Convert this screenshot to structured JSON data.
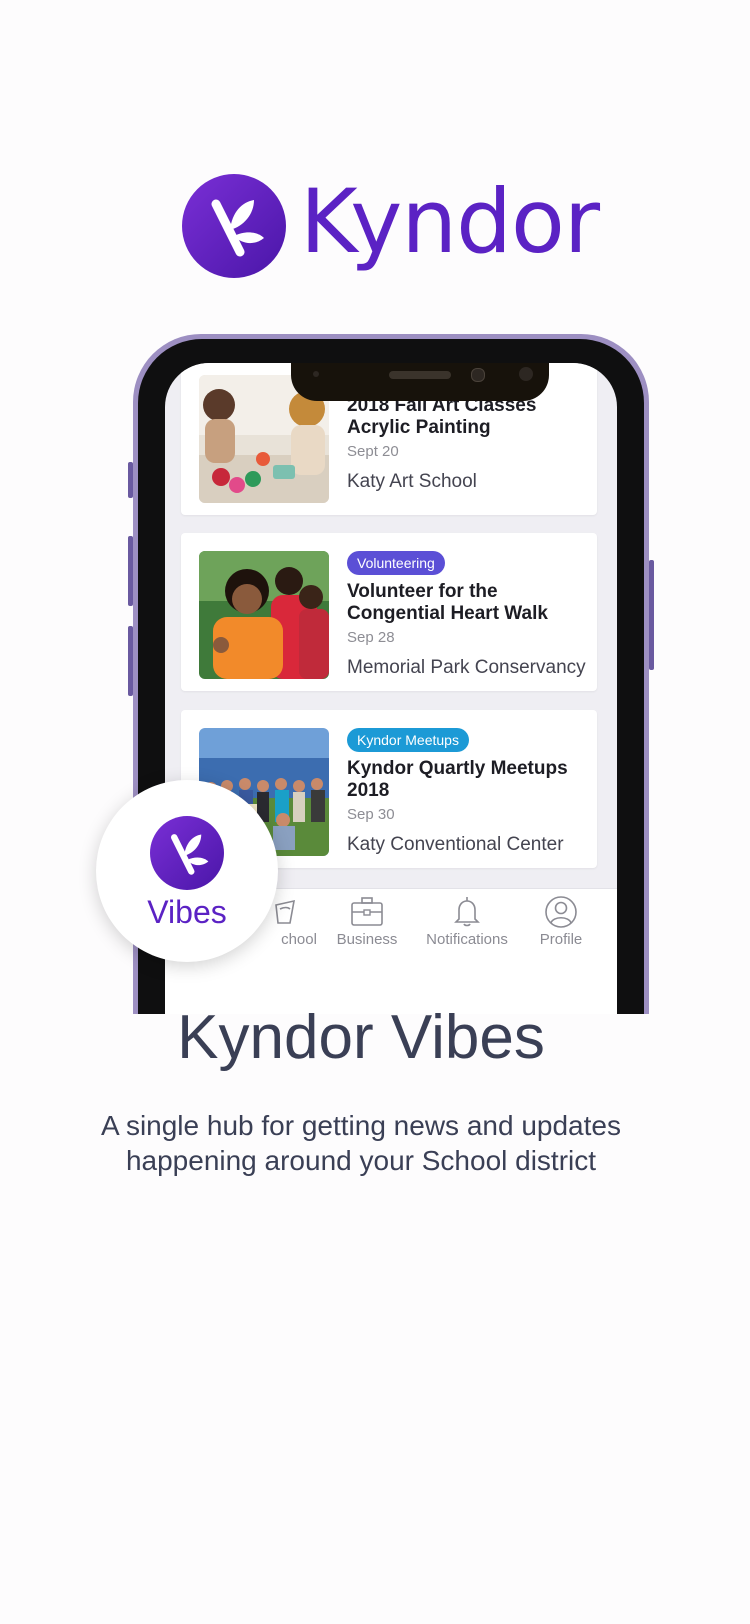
{
  "brand": {
    "name": "Kyndor",
    "logo_icon": "kyndor-leaf-icon",
    "color": "#5b22c4"
  },
  "feed": {
    "cards": [
      {
        "tag": "",
        "title": "2018 Fall Art Classes Acrylic Painting",
        "date": "Sept 20",
        "venue": "Katy Art School",
        "image": "art-class-photo"
      },
      {
        "tag": "Volunteering",
        "tag_color": "#5b4fd6",
        "title": "Volunteer for the Congential Heart Walk",
        "date": "Sep 28",
        "venue": "Memorial Park Conservancy",
        "image": "volunteers-photo"
      },
      {
        "tag": "Kyndor Meetups",
        "tag_color": "#1c9ad6",
        "title": "Kyndor Quartly Meetups 2018",
        "date": "Sep 30",
        "venue": "Katy Conventional Center",
        "image": "meetup-group-photo"
      }
    ]
  },
  "tabbar": {
    "items": [
      {
        "label": "School",
        "visible_label": "chool",
        "icon": "school-icon"
      },
      {
        "label": "Business",
        "icon": "briefcase-icon"
      },
      {
        "label": "Notifications",
        "icon": "bell-icon"
      },
      {
        "label": "Profile",
        "icon": "profile-icon"
      }
    ]
  },
  "vibes_badge": {
    "label": "Vibes",
    "icon": "kyndor-leaf-icon"
  },
  "hero": {
    "title": "Kyndor Vibes",
    "subtitle": "A single hub for getting news and updates happening around your School district"
  }
}
